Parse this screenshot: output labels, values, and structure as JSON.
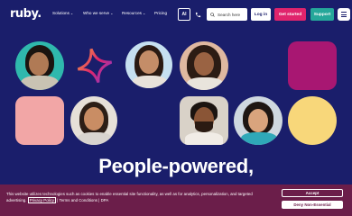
{
  "nav": {
    "logo": "ruby.",
    "links": [
      {
        "label": "Solutions",
        "chevron": "⌄"
      },
      {
        "label": "Who we serve",
        "chevron": "⌄"
      },
      {
        "label": "Resources",
        "chevron": "⌄"
      },
      {
        "label": "Pricing",
        "chevron": ""
      }
    ],
    "ai_label": "AI",
    "search_placeholder": "Search here",
    "login_label": "Log in",
    "get_started_label": "Get started",
    "support_label": "Support"
  },
  "hero": {
    "headline_line1": "People-powered,",
    "headline_line2": "[partially hidden]"
  },
  "cookie_banner": {
    "text_before": "This website utilizes technologies such as cookies to enable essential site functionality, as well as for analytics, personalization, and targeted advertising.",
    "privacy_link": "Privacy Policy",
    "terms_link": "Terms and Conditions",
    "separator": "|",
    "dpa_link": "DPA",
    "accept_label": "Accept",
    "deny_label": "Deny Non-Essential"
  },
  "colors": {
    "background": "#1a1e6b",
    "brand_pink": "#e0246c",
    "support_teal": "#25a79a",
    "cookie_bg": "#6b1e4a"
  }
}
